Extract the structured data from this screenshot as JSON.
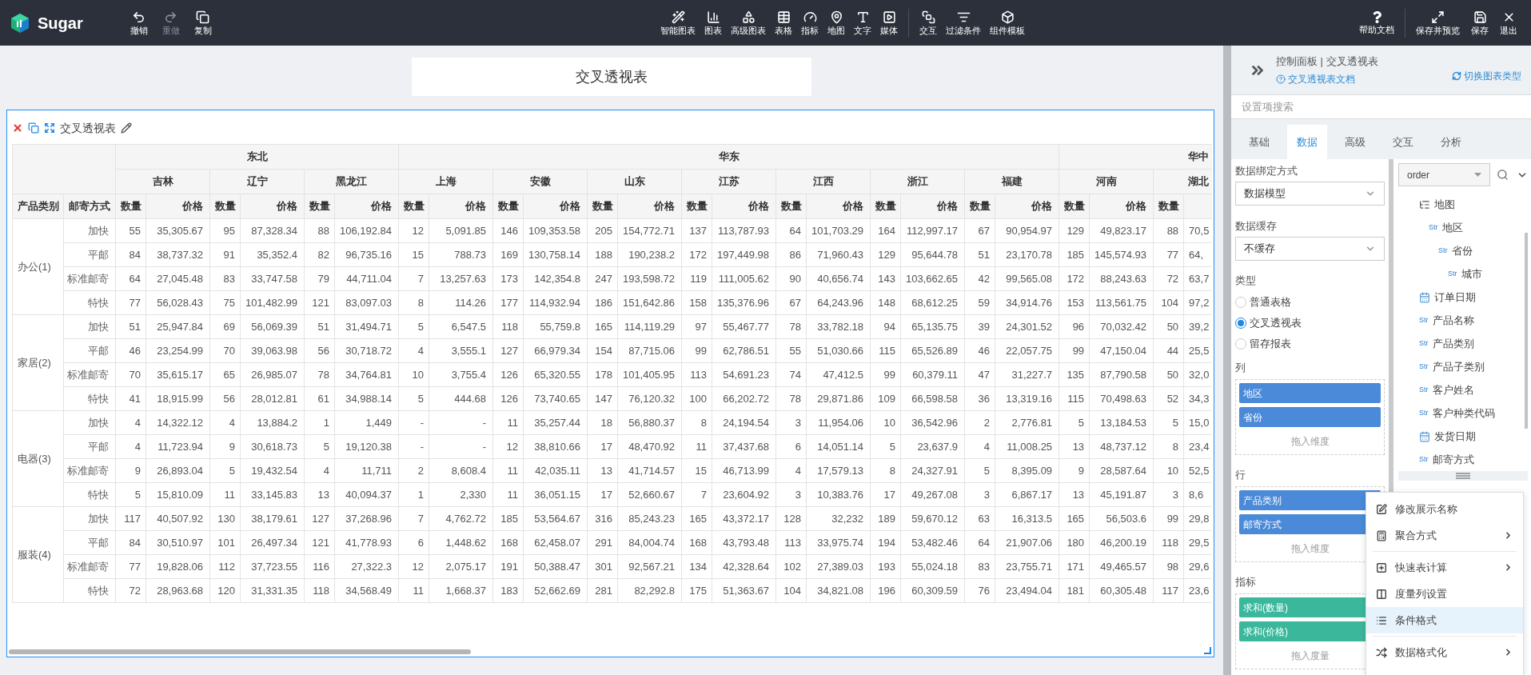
{
  "topbar": {
    "logo": "Sugar",
    "history": [
      {
        "kind": "undo",
        "label": "撤销",
        "disabled": false
      },
      {
        "kind": "redo",
        "label": "重做",
        "disabled": true
      },
      {
        "kind": "copy",
        "label": "复制",
        "disabled": false
      }
    ],
    "insert": [
      {
        "kind": "smart",
        "label": "智能图表"
      },
      {
        "kind": "chart",
        "label": "图表"
      },
      {
        "kind": "advanced",
        "label": "高级图表"
      },
      {
        "kind": "table",
        "label": "表格"
      },
      {
        "kind": "gauge",
        "label": "指标"
      },
      {
        "kind": "map",
        "label": "地图"
      },
      {
        "kind": "text",
        "label": "文字"
      },
      {
        "kind": "media",
        "label": "媒体"
      }
    ],
    "components": [
      {
        "kind": "interact",
        "label": "交互"
      },
      {
        "kind": "filter",
        "label": "过滤条件"
      },
      {
        "kind": "template",
        "label": "组件模板"
      }
    ],
    "help": [
      {
        "kind": "help",
        "label": "帮助文档"
      }
    ],
    "actions": [
      {
        "kind": "preview",
        "label": "保存并预览"
      },
      {
        "kind": "save",
        "label": "保存"
      },
      {
        "kind": "exit",
        "label": "退出"
      }
    ]
  },
  "canvas": {
    "title": "交叉透视表",
    "widget_title": "交叉透视表",
    "table": {
      "row_headers": [
        "产品类别",
        "邮寄方式"
      ],
      "regions": [
        {
          "label": "东北",
          "provinces": [
            {
              "label": "吉林",
              "measures": [
                "数量",
                "价格"
              ]
            },
            {
              "label": "辽宁",
              "measures": [
                "数量",
                "价格"
              ]
            },
            {
              "label": "黑龙江",
              "measures": [
                "数量",
                "价格"
              ]
            }
          ]
        },
        {
          "label": "华东",
          "provinces": [
            {
              "label": "上海",
              "measures": [
                "数量",
                "价格"
              ]
            },
            {
              "label": "安徽",
              "measures": [
                "数量",
                "价格"
              ]
            },
            {
              "label": "山东",
              "measures": [
                "数量",
                "价格"
              ]
            },
            {
              "label": "江苏",
              "measures": [
                "数量",
                "价格"
              ]
            },
            {
              "label": "江西",
              "measures": [
                "数量",
                "价格"
              ]
            },
            {
              "label": "浙江",
              "measures": [
                "数量",
                "价格"
              ]
            },
            {
              "label": "福建",
              "measures": [
                "数量",
                "价格"
              ]
            }
          ]
        },
        {
          "label": "华中",
          "provinces": [
            {
              "label": "河南",
              "measures": [
                "数量",
                "价格"
              ]
            },
            {
              "label": "湖北",
              "measures": [
                "数量"
              ]
            }
          ]
        }
      ],
      "groups": [
        {
          "label": "办公(1)",
          "rows": [
            {
              "method": "加快",
              "cells": [
                "55",
                "35,305.67",
                "95",
                "87,328.34",
                "88",
                "106,192.84",
                "12",
                "5,091.85",
                "146",
                "109,353.58",
                "205",
                "154,772.71",
                "137",
                "113,787.93",
                "64",
                "101,703.29",
                "164",
                "112,997.17",
                "67",
                "90,954.97",
                "129",
                "49,823.17",
                "88",
                "70,5"
              ]
            },
            {
              "method": "平邮",
              "cells": [
                "84",
                "38,737.32",
                "91",
                "35,352.4",
                "82",
                "96,735.16",
                "15",
                "788.73",
                "169",
                "130,758.14",
                "188",
                "190,238.2",
                "172",
                "197,449.98",
                "86",
                "71,960.43",
                "129",
                "95,644.78",
                "51",
                "23,170.78",
                "185",
                "145,574.93",
                "77",
                "64,"
              ]
            },
            {
              "method": "标准邮寄",
              "cells": [
                "64",
                "27,045.48",
                "83",
                "33,747.58",
                "79",
                "44,711.04",
                "7",
                "13,257.63",
                "173",
                "142,354.8",
                "247",
                "193,598.72",
                "119",
                "111,005.62",
                "90",
                "40,656.74",
                "143",
                "103,662.65",
                "42",
                "99,565.08",
                "172",
                "88,243.63",
                "72",
                "63,7"
              ]
            },
            {
              "method": "特快",
              "cells": [
                "77",
                "56,028.43",
                "75",
                "101,482.99",
                "121",
                "83,097.03",
                "8",
                "114.26",
                "177",
                "114,932.94",
                "186",
                "151,642.86",
                "158",
                "135,376.96",
                "67",
                "64,243.96",
                "148",
                "68,612.25",
                "59",
                "34,914.76",
                "153",
                "113,561.75",
                "104",
                "97,2"
              ]
            }
          ]
        },
        {
          "label": "家居(2)",
          "rows": [
            {
              "method": "加快",
              "cells": [
                "51",
                "25,947.84",
                "69",
                "56,069.39",
                "51",
                "31,494.71",
                "5",
                "6,547.5",
                "118",
                "55,759.8",
                "165",
                "114,119.29",
                "97",
                "55,467.77",
                "78",
                "33,782.18",
                "94",
                "65,135.75",
                "39",
                "24,301.52",
                "96",
                "70,032.42",
                "50",
                "39,2"
              ]
            },
            {
              "method": "平邮",
              "cells": [
                "46",
                "23,254.99",
                "70",
                "39,063.98",
                "56",
                "30,718.72",
                "4",
                "3,555.1",
                "127",
                "66,979.34",
                "154",
                "87,715.06",
                "99",
                "62,786.51",
                "55",
                "51,030.66",
                "115",
                "65,526.89",
                "46",
                "22,057.75",
                "99",
                "47,150.04",
                "44",
                "25,5"
              ]
            },
            {
              "method": "标准邮寄",
              "cells": [
                "70",
                "35,615.17",
                "65",
                "26,985.07",
                "78",
                "34,764.81",
                "10",
                "3,755.4",
                "126",
                "65,320.55",
                "178",
                "101,405.95",
                "113",
                "54,691.23",
                "74",
                "47,412.5",
                "99",
                "60,379.11",
                "47",
                "31,227.7",
                "135",
                "87,790.58",
                "50",
                "32,0"
              ]
            },
            {
              "method": "特快",
              "cells": [
                "41",
                "18,915.99",
                "56",
                "28,012.81",
                "61",
                "34,988.14",
                "5",
                "444.68",
                "126",
                "73,740.65",
                "147",
                "76,120.32",
                "100",
                "66,202.72",
                "78",
                "29,871.86",
                "109",
                "66,598.58",
                "36",
                "13,319.16",
                "115",
                "70,498.63",
                "52",
                "34,3"
              ]
            }
          ]
        },
        {
          "label": "电器(3)",
          "rows": [
            {
              "method": "加快",
              "cells": [
                "4",
                "14,322.12",
                "4",
                "13,884.2",
                "1",
                "1,449",
                "-",
                "-",
                "11",
                "35,257.44",
                "18",
                "56,880.37",
                "8",
                "24,194.54",
                "3",
                "11,954.06",
                "10",
                "36,542.96",
                "2",
                "2,776.81",
                "5",
                "13,184.53",
                "5",
                "15,0"
              ]
            },
            {
              "method": "平邮",
              "cells": [
                "4",
                "11,723.94",
                "9",
                "30,618.73",
                "5",
                "19,120.38",
                "-",
                "-",
                "12",
                "38,810.66",
                "17",
                "48,470.92",
                "11",
                "37,437.68",
                "6",
                "14,051.14",
                "5",
                "23,637.9",
                "4",
                "11,008.25",
                "13",
                "48,737.12",
                "8",
                "23,4"
              ]
            },
            {
              "method": "标准邮寄",
              "cells": [
                "9",
                "26,893.04",
                "5",
                "19,432.54",
                "4",
                "11,711",
                "2",
                "8,608.4",
                "11",
                "42,035.11",
                "13",
                "41,714.57",
                "15",
                "46,713.99",
                "4",
                "17,579.13",
                "8",
                "24,327.91",
                "5",
                "8,395.09",
                "9",
                "28,587.64",
                "10",
                "52,5"
              ]
            },
            {
              "method": "特快",
              "cells": [
                "5",
                "15,810.09",
                "11",
                "33,145.83",
                "13",
                "40,094.37",
                "1",
                "2,330",
                "11",
                "36,051.15",
                "17",
                "52,660.67",
                "7",
                "23,604.92",
                "3",
                "10,383.76",
                "17",
                "49,267.08",
                "3",
                "6,867.17",
                "13",
                "45,191.87",
                "3",
                "8,6"
              ]
            }
          ]
        },
        {
          "label": "服装(4)",
          "rows": [
            {
              "method": "加快",
              "cells": [
                "117",
                "40,507.92",
                "130",
                "38,179.61",
                "127",
                "37,268.96",
                "7",
                "4,762.72",
                "185",
                "53,564.67",
                "316",
                "85,243.23",
                "165",
                "43,372.17",
                "128",
                "32,232",
                "189",
                "59,670.12",
                "63",
                "16,313.5",
                "165",
                "56,503.6",
                "99",
                "29,8"
              ]
            },
            {
              "method": "平邮",
              "cells": [
                "84",
                "30,510.97",
                "101",
                "26,497.34",
                "121",
                "41,778.93",
                "6",
                "1,448.62",
                "168",
                "62,458.07",
                "291",
                "84,004.74",
                "168",
                "43,793.48",
                "113",
                "33,975.74",
                "194",
                "53,482.46",
                "64",
                "21,907.06",
                "180",
                "46,200.19",
                "118",
                "29,5"
              ]
            },
            {
              "method": "标准邮寄",
              "cells": [
                "77",
                "19,828.06",
                "112",
                "37,723.55",
                "116",
                "27,322.3",
                "12",
                "2,075.17",
                "191",
                "50,388.47",
                "301",
                "92,567.21",
                "134",
                "42,328.64",
                "102",
                "27,389.03",
                "193",
                "55,024.18",
                "83",
                "23,755.71",
                "171",
                "49,465.57",
                "98",
                "29,6"
              ]
            },
            {
              "method": "特快",
              "cells": [
                "72",
                "28,963.68",
                "120",
                "31,331.35",
                "118",
                "34,568.49",
                "11",
                "1,668.37",
                "183",
                "52,662.69",
                "281",
                "82,292.8",
                "175",
                "51,363.67",
                "104",
                "34,821.08",
                "196",
                "60,309.59",
                "76",
                "23,494.04",
                "181",
                "60,305.48",
                "117",
                "23,6"
              ]
            }
          ]
        }
      ]
    }
  },
  "panel": {
    "title": "控制面板 | 交叉透视表",
    "doc_link": "交叉透视表文档",
    "switch_link": "切换图表类型",
    "search": {
      "placeholder": "设置项搜索"
    },
    "tabs": [
      {
        "label": "基础",
        "selected": false
      },
      {
        "label": "数据",
        "selected": true
      },
      {
        "label": "高级",
        "selected": false
      },
      {
        "label": "交互",
        "selected": false
      },
      {
        "label": "分析",
        "selected": false
      }
    ],
    "binding": {
      "label": "数据绑定方式",
      "value": "数据模型"
    },
    "cache": {
      "label": "数据缓存",
      "value": "不缓存"
    },
    "type": {
      "label": "类型",
      "options": [
        {
          "label": "普通表格",
          "selected": false
        },
        {
          "label": "交叉透视表",
          "selected": true
        },
        {
          "label": "留存报表",
          "selected": false
        }
      ]
    },
    "zones": [
      {
        "title": "列",
        "kind": "dimension",
        "chips": [
          "地区",
          "省份"
        ],
        "hint": "拖入维度"
      },
      {
        "title": "行",
        "kind": "dimension",
        "chips": [
          "产品类别",
          "邮寄方式"
        ],
        "hint": "拖入维度"
      },
      {
        "title": "指标",
        "kind": "measure",
        "chips": [
          "求和(数量)",
          "求和(价格)"
        ],
        "hint": "拖入度量"
      }
    ],
    "source": {
      "value": "order"
    },
    "fields": [
      {
        "kind": "hierarchy",
        "label": "地图",
        "children": [
          {
            "kind": "str",
            "badge": "Str",
            "label": "地区",
            "children": [
              {
                "kind": "str",
                "badge": "Str",
                "label": "省份",
                "children": [
                  {
                    "kind": "str",
                    "badge": "Str",
                    "label": "城市"
                  }
                ]
              }
            ]
          }
        ]
      },
      {
        "kind": "date",
        "label": "订单日期"
      },
      {
        "kind": "str",
        "badge": "Str",
        "label": "产品名称"
      },
      {
        "kind": "str",
        "badge": "Str",
        "label": "产品类别"
      },
      {
        "kind": "str",
        "badge": "Str",
        "label": "产品子类别"
      },
      {
        "kind": "str",
        "badge": "Str",
        "label": "客户姓名"
      },
      {
        "kind": "str",
        "badge": "Str",
        "label": "客户种类代码"
      },
      {
        "kind": "date",
        "label": "发货日期"
      },
      {
        "kind": "str",
        "badge": "Str",
        "label": "邮寄方式"
      }
    ],
    "menu": [
      {
        "kind": "edit",
        "label": "修改展示名称",
        "submenu": false,
        "selected": false
      },
      {
        "kind": "aggregate",
        "label": "聚合方式",
        "submenu": true,
        "selected": false
      },
      {
        "kind": "divider"
      },
      {
        "kind": "quick",
        "label": "快速表计算",
        "submenu": true,
        "selected": false
      },
      {
        "kind": "columns",
        "label": "度量列设置",
        "submenu": false,
        "selected": false
      },
      {
        "kind": "conditional",
        "label": "条件格式",
        "submenu": false,
        "selected": true
      },
      {
        "kind": "divider"
      },
      {
        "kind": "format",
        "label": "数据格式化",
        "submenu": true,
        "selected": false
      }
    ]
  }
}
